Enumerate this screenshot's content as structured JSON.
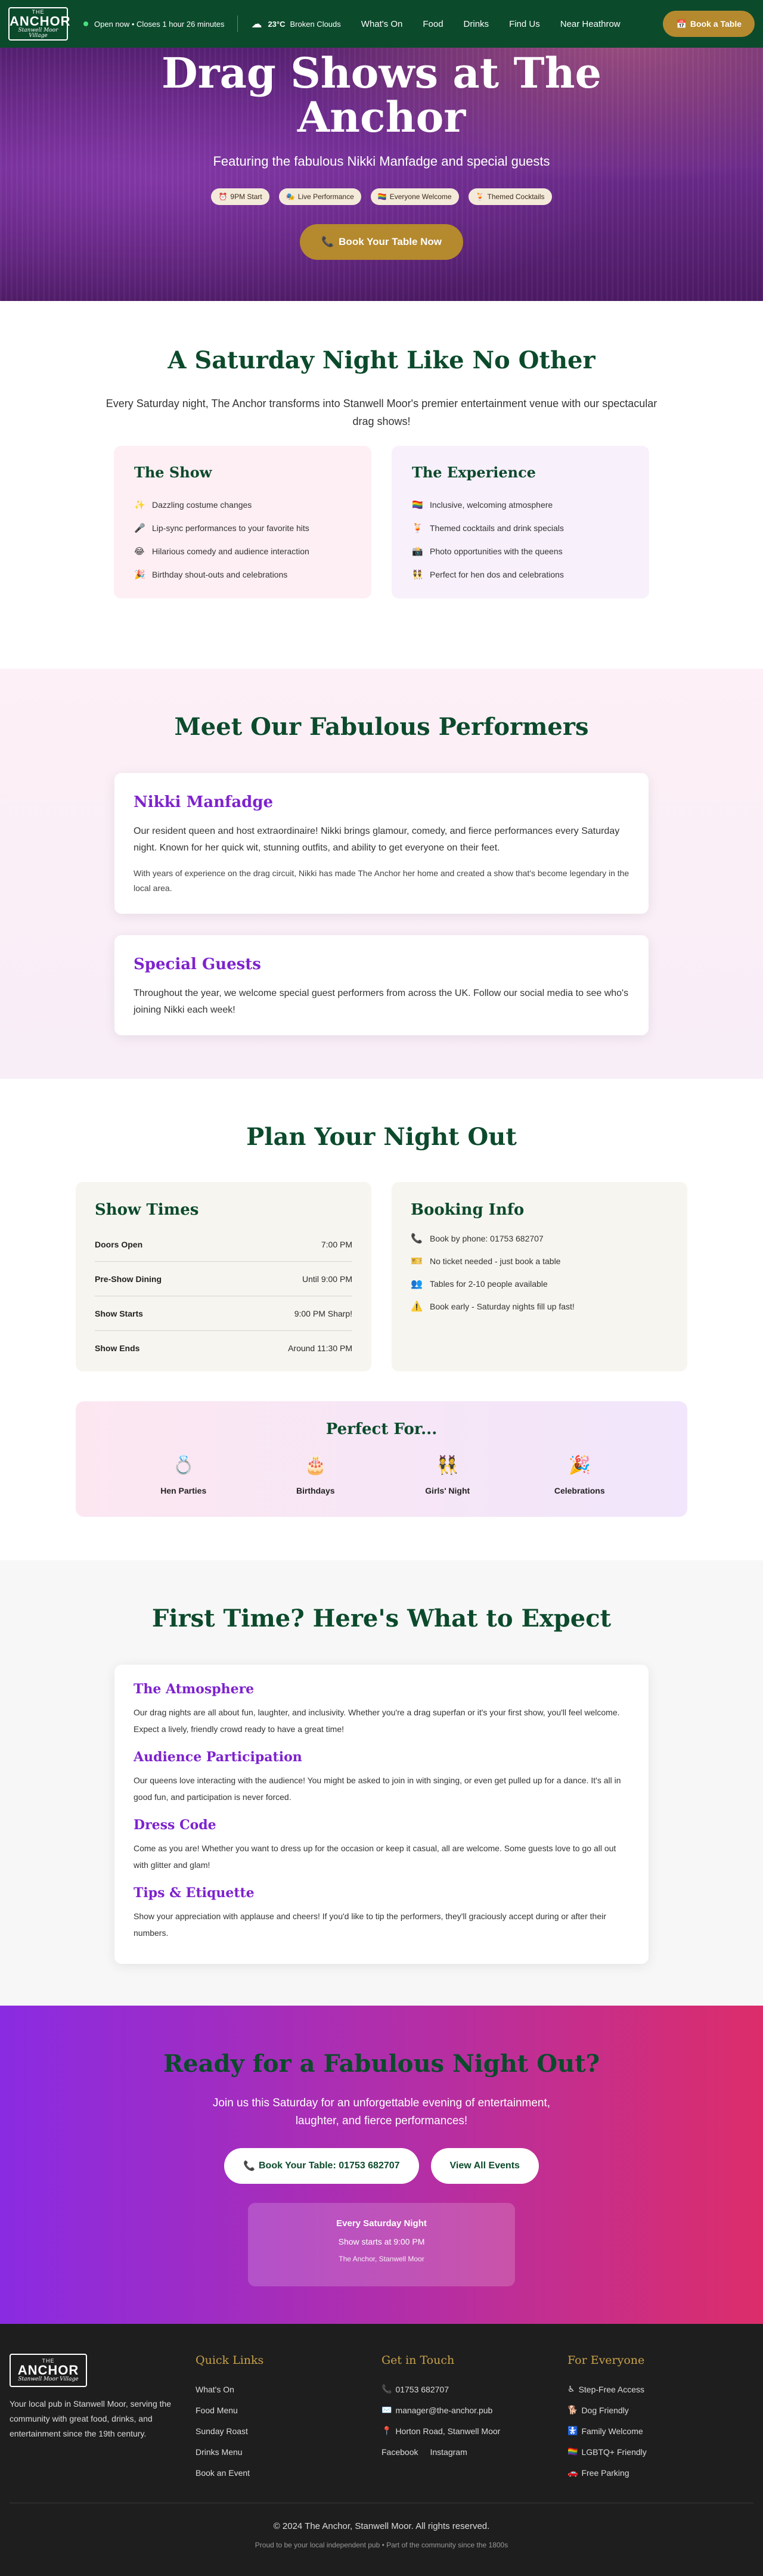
{
  "nav": {
    "logo": {
      "top": "THE",
      "name": "ANCHOR",
      "tag": "Stanwell Moor Village"
    },
    "status": "Open now • Closes 1 hour 26 minutes",
    "weather": {
      "temp": "23°C",
      "desc": "Broken Clouds"
    },
    "links": [
      "What's On",
      "Food",
      "Drinks",
      "Find Us",
      "Near Heathrow"
    ],
    "book_label": "Book a Table"
  },
  "hero": {
    "title": "Drag Shows at The Anchor",
    "subtitle": "Featuring the fabulous Nikki Manfadge and special guests",
    "pills": [
      {
        "icon": "⏰",
        "label": "9PM Start"
      },
      {
        "icon": "🎭",
        "label": "Live Performance"
      },
      {
        "icon": "🏳️‍🌈",
        "label": "Everyone Welcome"
      },
      {
        "icon": "🍹",
        "label": "Themed Cocktails"
      }
    ],
    "cta": "Book Your Table Now"
  },
  "intro": {
    "title": "A Saturday Night Like No Other",
    "lead": "Every Saturday night, The Anchor transforms into Stanwell Moor's premier entertainment venue with our spectacular drag shows!",
    "show": {
      "title": "The Show",
      "items": [
        {
          "icon": "✨",
          "text": "Dazzling costume changes"
        },
        {
          "icon": "🎤",
          "text": "Lip-sync performances to your favorite hits"
        },
        {
          "icon": "😂",
          "text": "Hilarious comedy and audience interaction"
        },
        {
          "icon": "🎉",
          "text": "Birthday shout-outs and celebrations"
        }
      ]
    },
    "experience": {
      "title": "The Experience",
      "items": [
        {
          "icon": "🏳️‍🌈",
          "text": "Inclusive, welcoming atmosphere"
        },
        {
          "icon": "🍹",
          "text": "Themed cocktails and drink specials"
        },
        {
          "icon": "📸",
          "text": "Photo opportunities with the queens"
        },
        {
          "icon": "👯",
          "text": "Perfect for hen dos and celebrations"
        }
      ]
    }
  },
  "performers": {
    "title": "Meet Our Fabulous Performers",
    "nikki": {
      "name": "Nikki Manfadge",
      "p1": "Our resident queen and host extraordinaire! Nikki brings glamour, comedy, and fierce performances every Saturday night. Known for her quick wit, stunning outfits, and ability to get everyone on their feet.",
      "p2": "With years of experience on the drag circuit, Nikki has made The Anchor her home and created a show that's become legendary in the local area."
    },
    "guests": {
      "name": "Special Guests",
      "p1": "Throughout the year, we welcome special guest performers from across the UK. Follow our social media to see who's joining Nikki each week!"
    }
  },
  "plan": {
    "title": "Plan Your Night Out",
    "times": {
      "title": "Show Times",
      "rows": [
        {
          "label": "Doors Open",
          "value": "7:00 PM"
        },
        {
          "label": "Pre-Show Dining",
          "value": "Until 9:00 PM"
        },
        {
          "label": "Show Starts",
          "value": "9:00 PM Sharp!"
        },
        {
          "label": "Show Ends",
          "value": "Around 11:30 PM"
        }
      ]
    },
    "booking": {
      "title": "Booking Info",
      "rows": [
        {
          "icon": "📞",
          "text": "Book by phone: 01753 682707"
        },
        {
          "icon": "🎫",
          "text": "No ticket needed - just book a table"
        },
        {
          "icon": "👥",
          "text": "Tables for 2-10 people available"
        },
        {
          "icon": "⚠️",
          "text": "Book early - Saturday nights fill up fast!"
        }
      ]
    },
    "perfect": {
      "title": "Perfect For...",
      "items": [
        {
          "icon": "💍",
          "label": "Hen Parties"
        },
        {
          "icon": "🎂",
          "label": "Birthdays"
        },
        {
          "icon": "👯",
          "label": "Girls' Night"
        },
        {
          "icon": "🎉",
          "label": "Celebrations"
        }
      ]
    }
  },
  "expect": {
    "title": "First Time? Here's What to Expect",
    "items": [
      {
        "heading": "The Atmosphere",
        "text": "Our drag nights are all about fun, laughter, and inclusivity. Whether you're a drag superfan or it's your first show, you'll feel welcome. Expect a lively, friendly crowd ready to have a great time!"
      },
      {
        "heading": "Audience Participation",
        "text": "Our queens love interacting with the audience! You might be asked to join in with singing, or even get pulled up for a dance. It's all in good fun, and participation is never forced."
      },
      {
        "heading": "Dress Code",
        "text": "Come as you are! Whether you want to dress up for the occasion or keep it casual, all are welcome. Some guests love to go all out with glitter and glam!"
      },
      {
        "heading": "Tips & Etiquette",
        "text": "Show your appreciation with applause and cheers! If you'd like to tip the performers, they'll graciously accept during or after their numbers."
      }
    ]
  },
  "cta": {
    "title": "Ready for a Fabulous Night Out?",
    "lead": "Join us this Saturday for an unforgettable evening of entertainment, laughter, and fierce performances!",
    "book": "Book Your Table: 01753 682707",
    "events": "View All Events",
    "box": {
      "t1": "Every Saturday Night",
      "t2": "Show starts at 9:00 PM",
      "t3": "The Anchor, Stanwell Moor"
    }
  },
  "footer": {
    "about": "Your local pub in Stanwell Moor, serving the community with great food, drinks, and entertainment since the 19th century.",
    "quick": {
      "title": "Quick Links",
      "links": [
        "What's On",
        "Food Menu",
        "Sunday Roast",
        "Drinks Menu",
        "Book an Event"
      ]
    },
    "contact": {
      "title": "Get in Touch",
      "phone": "01753 682707",
      "email": "manager@the-anchor.pub",
      "address": "Horton Road, Stanwell Moor",
      "social": [
        "Facebook",
        "Instagram"
      ]
    },
    "everyone": {
      "title": "For Everyone",
      "items": [
        {
          "icon": "♿",
          "text": "Step-Free Access"
        },
        {
          "icon": "🐕",
          "text": "Dog Friendly"
        },
        {
          "icon": "🚼",
          "text": "Family Welcome"
        },
        {
          "icon": "🏳️‍🌈",
          "text": "LGBTQ+ Friendly"
        },
        {
          "icon": "🚗",
          "text": "Free Parking"
        }
      ]
    },
    "copyright": "© 2024 The Anchor, Stanwell Moor. All rights reserved.",
    "tagline": "Proud to be your local independent pub • Part of the community since the 1800s"
  }
}
